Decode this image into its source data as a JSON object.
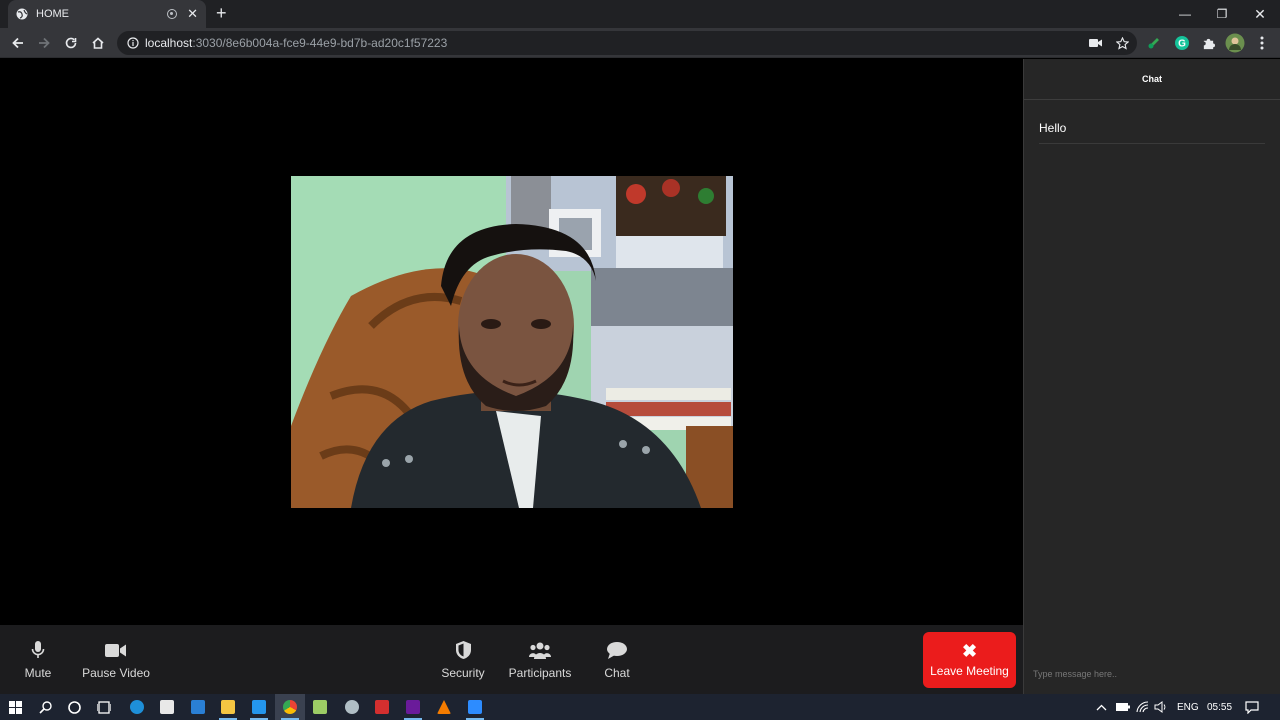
{
  "browser": {
    "tab_title": "HOME",
    "url_host": "localhost",
    "url_rest": ":3030/8e6b004a-fce9-44e9-bd7b-ad20c1f57223"
  },
  "icons": {
    "tab_favicon": "globe-icon",
    "omnibox": "info-icon",
    "nav": [
      "back-arrow-icon",
      "forward-arrow-icon",
      "reload-icon",
      "home-icon"
    ],
    "extensions": [
      "camera-icon",
      "star-icon",
      "extension-green-icon",
      "grammarly-icon",
      "puzzle-icon",
      "profile-avatar-icon",
      "menu-dots-icon"
    ],
    "controls": [
      "microphone-icon",
      "video-camera-icon",
      "shield-icon",
      "people-icon",
      "chat-bubble-icon",
      "x-icon"
    ]
  },
  "controls": {
    "mute": "Mute",
    "pause_video": "Pause Video",
    "security": "Security",
    "participants": "Participants",
    "chat": "Chat",
    "leave": "Leave Meeting"
  },
  "chat_panel": {
    "title": "Chat",
    "messages": [
      "Hello"
    ],
    "input_placeholder": "Type message here.."
  },
  "taskbar": {
    "language": "ENG",
    "time": "05:55"
  },
  "colors": {
    "leave_button": "#eb1c1c",
    "chat_bg": "#262626",
    "controls_bg": "#1c1c1e",
    "browser_dark": "#202124"
  }
}
